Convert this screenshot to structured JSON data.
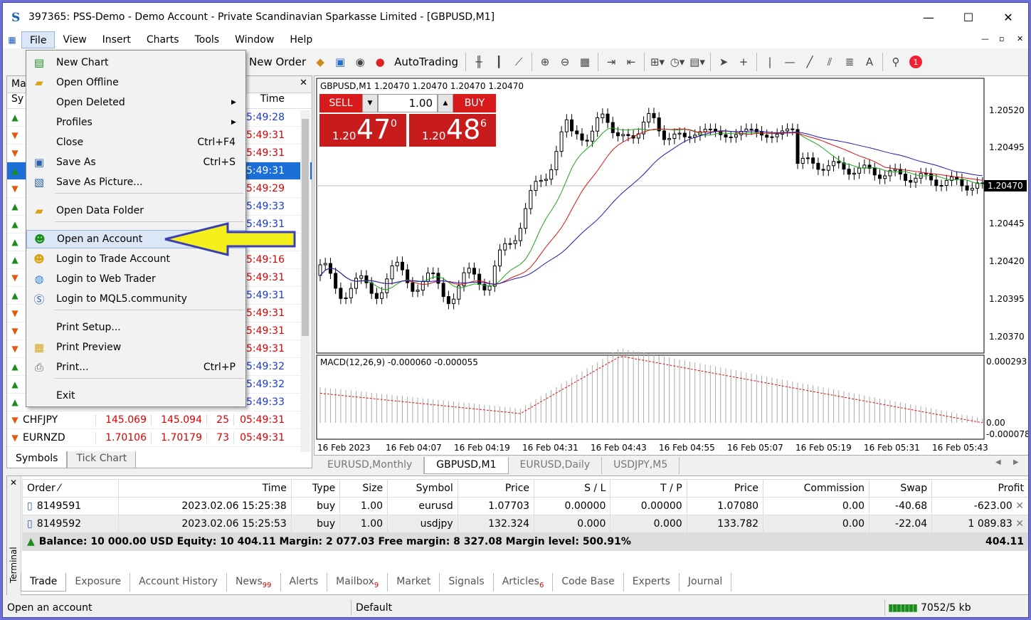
{
  "window": {
    "title": "397365: PSS-Demo - Demo Account - Private Scandinavian Sparkasse Limited - [GBPUSD,M1]"
  },
  "menu": [
    "File",
    "View",
    "Insert",
    "Charts",
    "Tools",
    "Window",
    "Help"
  ],
  "toolbar": {
    "new_order": "New Order",
    "autotrading": "AutoTrading",
    "notification_count": "1"
  },
  "file_menu": {
    "items": [
      {
        "label": "New Chart",
        "shortcut": "",
        "icon": "new-chart-icon"
      },
      {
        "label": "Open Offline",
        "shortcut": "",
        "icon": "folder-icon"
      },
      {
        "label": "Open Deleted",
        "shortcut": "",
        "submenu": true
      },
      {
        "label": "Profiles",
        "shortcut": "",
        "submenu": true
      },
      {
        "label": "Close",
        "shortcut": "Ctrl+F4"
      },
      {
        "label": "Save As",
        "shortcut": "Ctrl+S",
        "icon": "save-icon"
      },
      {
        "label": "Save As Picture...",
        "shortcut": "",
        "icon": "save-picture-icon"
      },
      {
        "label": "Open Data Folder",
        "shortcut": "",
        "icon": "folder-icon"
      },
      {
        "label": "Open an Account",
        "shortcut": "",
        "icon": "add-account-icon",
        "highlighted": true
      },
      {
        "label": "Login to Trade Account",
        "shortcut": "",
        "icon": "login-icon"
      },
      {
        "label": "Login to Web Trader",
        "shortcut": "",
        "icon": "globe-icon"
      },
      {
        "label": "Login to MQL5.community",
        "shortcut": "",
        "icon": "mql5-icon"
      },
      {
        "label": "Print Setup...",
        "shortcut": ""
      },
      {
        "label": "Print Preview",
        "shortcut": "",
        "icon": "print-preview-icon"
      },
      {
        "label": "Print...",
        "shortcut": "Ctrl+P",
        "icon": "printer-icon"
      },
      {
        "label": "Exit",
        "shortcut": ""
      }
    ]
  },
  "market_watch": {
    "title": "Ma",
    "col_symbol": "Sy",
    "col_time": "Time",
    "rows": [
      {
        "dir": "up",
        "time": "05:49:28",
        "color": "blue"
      },
      {
        "dir": "down",
        "time": "05:49:31",
        "color": "red"
      },
      {
        "dir": "down",
        "time": "05:49:31",
        "color": "red"
      },
      {
        "dir": "up",
        "time": "05:49:31",
        "color": "selected"
      },
      {
        "dir": "down",
        "time": "05:49:29",
        "color": "red"
      },
      {
        "dir": "up",
        "time": "05:49:33",
        "color": "blue"
      },
      {
        "dir": "up",
        "time": "05:49:31",
        "color": "blue"
      },
      {
        "dir": "up",
        "time": "",
        "color": "blue"
      },
      {
        "dir": "up",
        "time": "05:49:16",
        "color": "red"
      },
      {
        "dir": "down",
        "time": "05:49:31",
        "color": "red"
      },
      {
        "dir": "up",
        "time": "05:49:31",
        "color": "blue"
      },
      {
        "dir": "down",
        "time": "05:49:31",
        "color": "red"
      },
      {
        "dir": "down",
        "time": "05:49:31",
        "color": "red"
      },
      {
        "dir": "down",
        "time": "05:49:31",
        "color": "red"
      },
      {
        "dir": "up",
        "time": "05:49:32",
        "color": "blue"
      },
      {
        "dir": "up",
        "time": "05:49:32",
        "color": "blue"
      },
      {
        "dir": "up",
        "time": "05:49:33",
        "color": "blue"
      },
      {
        "dir": "down",
        "symbol": "CHFJPY",
        "bid": "145.069",
        "ask": "145.094",
        "spread": "25",
        "time": "05:49:31",
        "color": "red"
      },
      {
        "dir": "down",
        "symbol": "EURNZD",
        "bid": "1.70106",
        "ask": "1.70179",
        "spread": "73",
        "time": "05:49:31",
        "color": "red"
      }
    ],
    "tabs": [
      "Symbols",
      "Tick Chart"
    ]
  },
  "chart": {
    "header": "GBPUSD,M1  1.20470 1.20470 1.20470 1.20470",
    "sell_label": "SELL",
    "buy_label": "BUY",
    "volume": "1.00",
    "sell_prefix": "1.20",
    "sell_big": "47",
    "sell_sup": "0",
    "buy_prefix": "1.20",
    "buy_big": "48",
    "buy_sup": "6",
    "price_labels": [
      "1.20520",
      "1.20495",
      "1.20470",
      "1.20445",
      "1.20420",
      "1.20395",
      "1.20370"
    ],
    "current_price": "1.20470",
    "macd_header": "MACD(12,26,9) -0.000060 -0.000055",
    "macd_labels": [
      "0.000293",
      "0.00",
      "-0.000078"
    ],
    "time_labels": [
      "16 Feb 2023",
      "16 Feb 04:07",
      "16 Feb 04:19",
      "16 Feb 04:31",
      "16 Feb 04:43",
      "16 Feb 04:55",
      "16 Feb 05:07",
      "16 Feb 05:19",
      "16 Feb 05:31",
      "16 Feb 05:43"
    ],
    "tabs": [
      "EURUSD,Monthly",
      "GBPUSD,M1",
      "EURUSD,Daily",
      "USDJPY,M5"
    ],
    "active_tab": 1
  },
  "terminal": {
    "side_label": "Terminal",
    "columns": [
      "Order",
      "Time",
      "Type",
      "Size",
      "Symbol",
      "Price",
      "S / L",
      "T / P",
      "Price",
      "Commission",
      "Swap",
      "Profit"
    ],
    "rows": [
      [
        "8149591",
        "2023.02.06 15:25:38",
        "buy",
        "1.00",
        "eurusd",
        "1.07703",
        "0.00000",
        "0.00000",
        "1.07080",
        "0.00",
        "-40.68",
        "-623.00"
      ],
      [
        "8149592",
        "2023.02.06 15:25:53",
        "buy",
        "1.00",
        "usdjpy",
        "132.324",
        "0.000",
        "0.000",
        "133.782",
        "0.00",
        "-22.04",
        "1 089.83"
      ]
    ],
    "balance_line": "Balance: 10 000.00 USD  Equity: 10 404.11  Margin: 2 077.03  Free margin: 8 327.08  Margin level: 500.91%",
    "balance_profit": "404.11",
    "tabs": [
      {
        "label": "Trade",
        "badge": ""
      },
      {
        "label": "Exposure",
        "badge": ""
      },
      {
        "label": "Account History",
        "badge": ""
      },
      {
        "label": "News",
        "badge": "99"
      },
      {
        "label": "Alerts",
        "badge": ""
      },
      {
        "label": "Mailbox",
        "badge": "9"
      },
      {
        "label": "Market",
        "badge": ""
      },
      {
        "label": "Signals",
        "badge": ""
      },
      {
        "label": "Articles",
        "badge": "6"
      },
      {
        "label": "Code Base",
        "badge": ""
      },
      {
        "label": "Experts",
        "badge": ""
      },
      {
        "label": "Journal",
        "badge": ""
      }
    ]
  },
  "status": {
    "hint": "Open an account",
    "profile": "Default",
    "traffic": "7052/5 kb"
  },
  "colors": {
    "sell": "#d91a1a",
    "highlight": "#dbe7f6",
    "arrow": "#f4ee1a"
  }
}
